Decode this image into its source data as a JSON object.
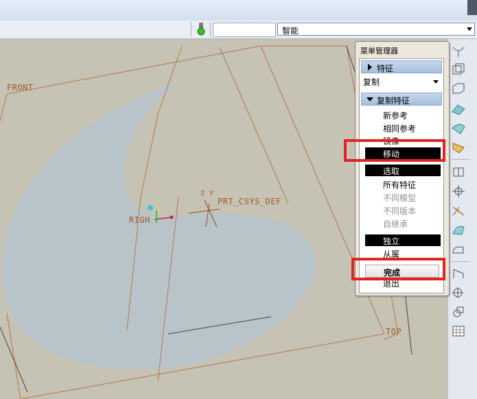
{
  "filter": {
    "value": "智能"
  },
  "model_labels": {
    "front": "FRONT",
    "right": "RIGH",
    "csys": "PRT_CSYS_DEF",
    "axes": "Z Y",
    "top": "TOP"
  },
  "menu_manager": {
    "title": "菜单管理器",
    "feature_header": "特征",
    "copy_combo": "复制",
    "copy_feature_header": "复制特征",
    "items_a": [
      "新参考",
      "相同参考",
      "镜像"
    ],
    "move": "移动",
    "select": "选取",
    "items_b": [
      "所有特征"
    ],
    "items_b_disabled": [
      "不同模型",
      "不同版本",
      "自继承"
    ],
    "independent": "独立",
    "dependent": "从属",
    "done": "完成",
    "exit": "退出"
  },
  "colors": {
    "surface": "#b9c4ca",
    "datum": "#b07a4a",
    "highlight": "#e02424",
    "menu_header": "#b3c8e3"
  },
  "right_toolbar_icons": [
    "sweep-icon",
    "extrude-icon",
    "shell-icon",
    "round-icon",
    "chamfer-icon",
    "draft-icon",
    "pattern-icon",
    "mirror-icon",
    "axis-icon",
    "rib-icon",
    "hole-icon",
    "surface-icon",
    "copy-icon",
    "datum-plane-icon",
    "sketch-icon",
    "grid-icon"
  ]
}
